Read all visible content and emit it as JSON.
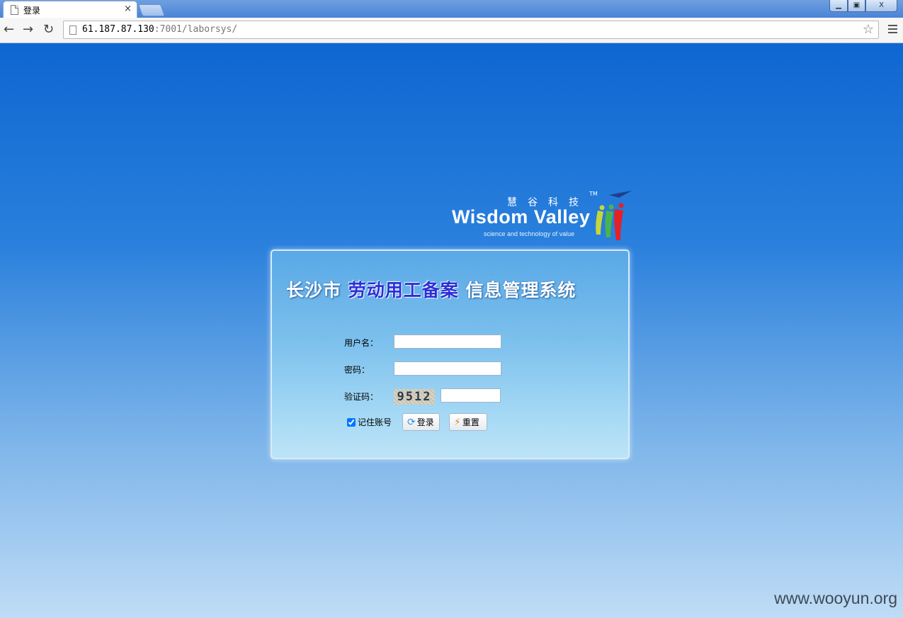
{
  "browser": {
    "tab_title": "登录",
    "tab_close": "×",
    "window_min": "▁",
    "window_max": "▣",
    "window_close": "X",
    "url_host": "61.187.87.130",
    "url_path": ":7001/laborsys/",
    "back_icon": "←",
    "forward_icon": "→",
    "reload_icon": "↻",
    "star_icon": "☆"
  },
  "logo": {
    "cn_name": "慧谷科技",
    "en_name": "Wisdom Valley",
    "trademark": "TM",
    "slogan": "science and technology of value",
    "colors": [
      "#c8d63a",
      "#4cb34c",
      "#e42126",
      "#1e3f8f"
    ]
  },
  "login": {
    "title_prefix": "长沙市",
    "title_highlight": "劳动用工备案",
    "title_suffix": "信息管理系统",
    "username_label": "用户名：",
    "username_value": "",
    "password_label": "密码：",
    "password_value": "",
    "captcha_label": "验证码：",
    "captcha_image_text": "9512",
    "captcha_value": "",
    "remember_label": "记住账号",
    "remember_checked": true,
    "login_button": "登录",
    "reset_button": "重置"
  },
  "watermark": "www.wooyun.org"
}
